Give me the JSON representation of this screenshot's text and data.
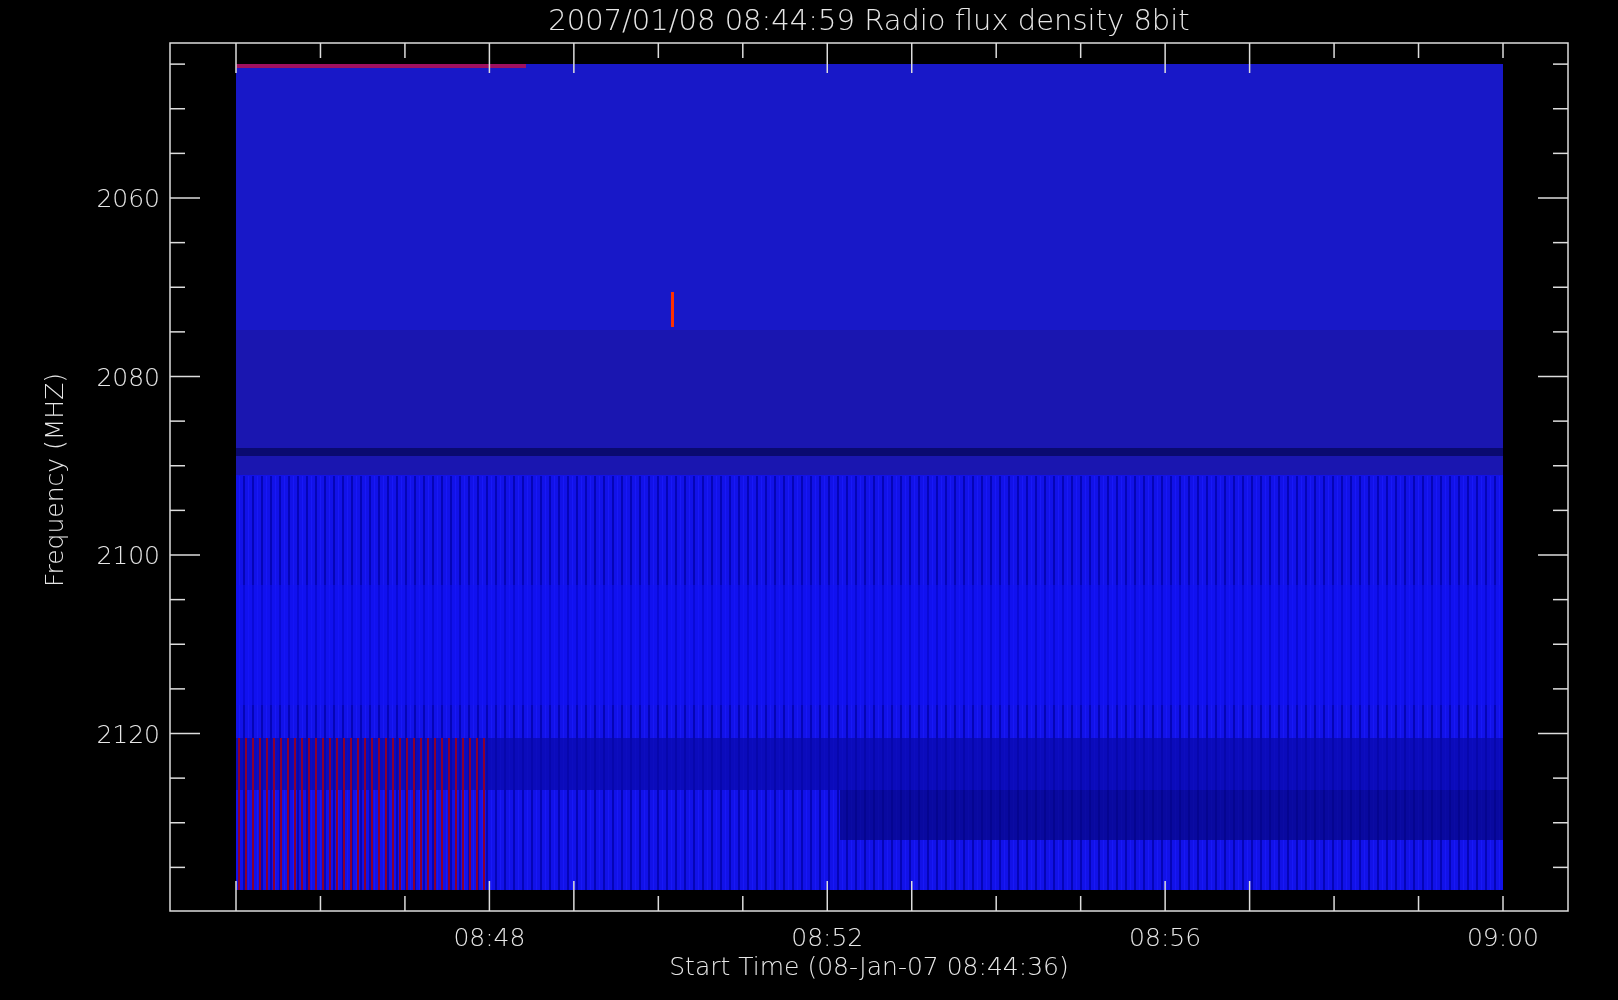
{
  "title": "2007/01/08 08:44:59 Radio flux density 8bit",
  "y_axis": {
    "label": "Frequency (MHZ)",
    "tick_labels": [
      "2060",
      "2080",
      "2100",
      "2120"
    ]
  },
  "x_axis": {
    "label": "Start Time (08-Jan-07 08:44:36)",
    "tick_labels": [
      "08:48",
      "08:52",
      "08:56",
      "09:00"
    ]
  }
}
